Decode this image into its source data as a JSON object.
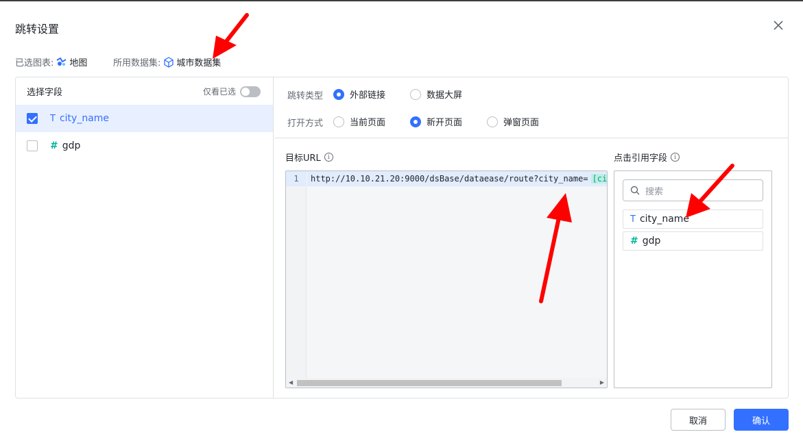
{
  "dialog": {
    "title": "跳转设置",
    "chart_label": "已选图表:",
    "chart_value": "地图",
    "dataset_label": "所用数据集:",
    "dataset_value": "城市数据集"
  },
  "fields_panel": {
    "header": "选择字段",
    "only_selected": "仅看已选",
    "items": [
      {
        "type": "T",
        "name": "city_name",
        "checked": true
      },
      {
        "type": "#",
        "name": "gdp",
        "checked": false
      }
    ]
  },
  "jump": {
    "type_label": "跳转类型",
    "type_options": [
      "外部链接",
      "数据大屏"
    ],
    "type_selected": "外部链接",
    "open_label": "打开方式",
    "open_options": [
      "当前页面",
      "新开页面",
      "弹窗页面"
    ],
    "open_selected": "新开页面"
  },
  "url": {
    "label": "目标URL",
    "line_number": "1",
    "code": "http://10.10.21.20:9000/dsBase/dataease/route?city_name=",
    "tag": "[city"
  },
  "ref": {
    "label": "点击引用字段",
    "search_placeholder": "搜索",
    "items": [
      {
        "type": "T",
        "name": "city_name"
      },
      {
        "type": "#",
        "name": "gdp"
      }
    ]
  },
  "footer": {
    "cancel": "取消",
    "confirm": "确认"
  },
  "colors": {
    "primary": "#3370ff",
    "annotation": "#ff0000"
  }
}
